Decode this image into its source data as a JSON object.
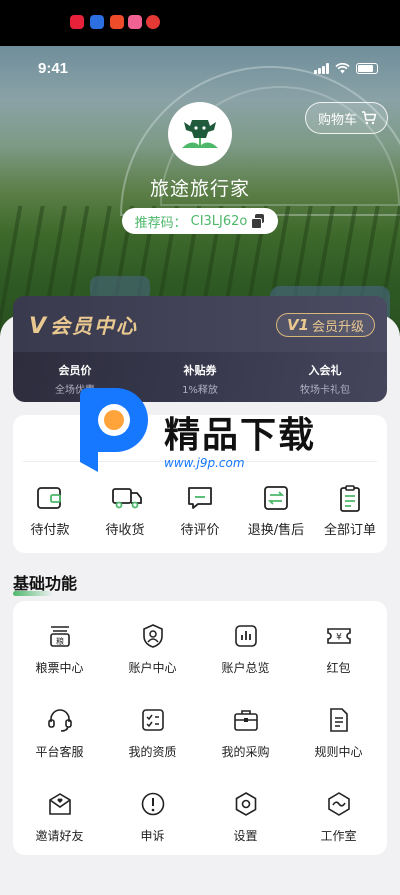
{
  "status": {
    "time": "9:41"
  },
  "header": {
    "cart_label": "购物车"
  },
  "profile": {
    "nickname": "旅途旅行家",
    "referral_label": "推荐码：",
    "referral_code": "CI3LJ62o"
  },
  "member": {
    "title": "会员中心",
    "upgrade_level": "V1",
    "upgrade_label": "会员升级",
    "perks": [
      {
        "title": "会员价",
        "subtitle": "全场优惠"
      },
      {
        "title": "补贴券",
        "subtitle": "1%释放"
      },
      {
        "title": "入会礼",
        "subtitle": "牧场卡礼包"
      }
    ]
  },
  "orders": {
    "items": [
      {
        "label": "待付款",
        "icon": "wallet-icon"
      },
      {
        "label": "待收货",
        "icon": "truck-icon"
      },
      {
        "label": "待评价",
        "icon": "comment-icon"
      },
      {
        "label": "退换/售后",
        "icon": "exchange-icon"
      },
      {
        "label": "全部订单",
        "icon": "clipboard-icon"
      }
    ]
  },
  "watermark": {
    "text": "精品下载",
    "url": "www.j9p.com"
  },
  "functions": {
    "title": "基础功能",
    "items": [
      {
        "label": "粮票中心",
        "icon": "grain-ticket-icon"
      },
      {
        "label": "账户中心",
        "icon": "account-shield-icon"
      },
      {
        "label": "账户总览",
        "icon": "bar-chart-icon"
      },
      {
        "label": "红包",
        "icon": "coupon-icon"
      },
      {
        "label": "平台客服",
        "icon": "headset-icon"
      },
      {
        "label": "我的资质",
        "icon": "checklist-icon"
      },
      {
        "label": "我的采购",
        "icon": "briefcase-icon"
      },
      {
        "label": "规则中心",
        "icon": "document-icon"
      },
      {
        "label": "邀请好友",
        "icon": "invite-mail-icon"
      },
      {
        "label": "申诉",
        "icon": "appeal-icon"
      },
      {
        "label": "设置",
        "icon": "settings-icon"
      },
      {
        "label": "工作室",
        "icon": "studio-icon"
      }
    ]
  },
  "colors": {
    "accent": "#4db86a",
    "gold": "#e9c98f",
    "card_dark": "#2c2c3c"
  }
}
